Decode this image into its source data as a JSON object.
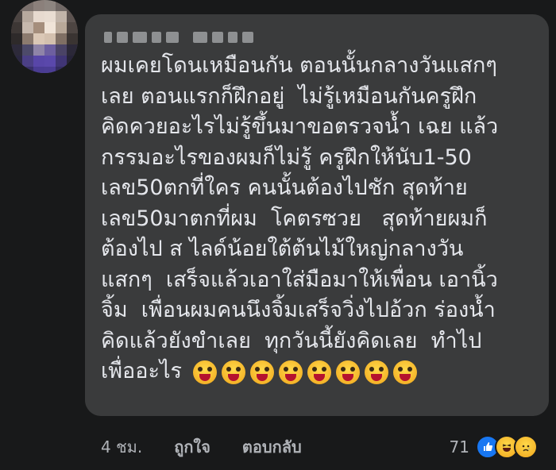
{
  "comment": {
    "author_name": "",
    "lines": [
      "ผมเคยโดนเหมือนกัน ตอนนั้นกลางวันแสกๆ",
      "เลย ตอนแรกก็ฝึกอยู่  ไม่รู้เหมือนกันครูฝึก",
      "คิดควยอะไรไม่รู้ขึ้นมาขอตรวจน้ำ เฉย แล้ว",
      "กรรมอะไรของผมก็ไม่รู้ ครูฝึกให้นับ1-50",
      "เลข50ตกที่ใคร คนนั้นต้องไปชัก สุดท้าย",
      "เลข50มาตกที่ผม  โคตรซวย   สุดท้ายผมก็",
      "ต้องไป ส ไลด์น้อยใต้ต้นไม้ใหญ่กลางวัน",
      "แสกๆ  เสร็จแล้วเอาใส่มือมาให้เพื่อน เอานิ้ว",
      "จิ้ม  เพื่อนผมคนนึงจิ้มเสร็จวิ่งไปอ้วก ร่องน้ำ",
      "คิดแล้วยังขำเลย  ทุกวันนี้ยังคิดเลย  ทำไป",
      "เพื่ออะไร"
    ],
    "emoji_name": "zany-face-emoji",
    "emoji_count": 8
  },
  "footer": {
    "time": "4 ชม.",
    "like_label": "ถูกใจ",
    "reply_label": "ตอบกลับ",
    "reaction_count": "71",
    "reactions": [
      "like-icon",
      "haha-icon",
      "sad-icon"
    ]
  },
  "colors": {
    "background": "#18191a",
    "bubble": "#3a3b3c",
    "text": "#e4e6eb",
    "secondary_text": "#b0b3b8",
    "like_blue": "#1877f2"
  }
}
